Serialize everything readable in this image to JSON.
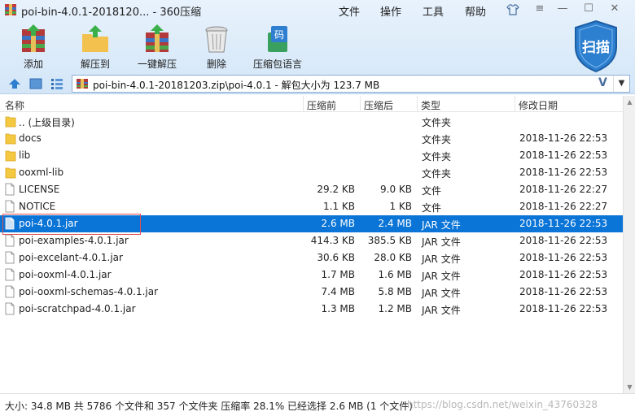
{
  "app": {
    "title": "poi-bin-4.0.1-2018120... - 360压缩"
  },
  "menu": [
    "文件",
    "操作",
    "工具",
    "帮助"
  ],
  "toolbar": {
    "add": "添加",
    "extract_to": "解压到",
    "one_click_extract": "一键解压",
    "delete": "删除",
    "password": "压缩包语言"
  },
  "scan": {
    "label": "扫描"
  },
  "address": {
    "path": "poi-bin-4.0.1-20181203.zip\\poi-4.0.1 - 解包大小为 123.7 MB",
    "v": "V"
  },
  "columns": {
    "name": "名称",
    "packed": "压缩前",
    "unpacked": "压缩后",
    "type": "类型",
    "modified": "修改日期"
  },
  "rows": [
    {
      "icon": "folder-icon",
      "name": ".. (上级目录)",
      "packed": "",
      "unpacked": "",
      "type": "文件夹",
      "date": ""
    },
    {
      "icon": "folder-icon",
      "name": "docs",
      "packed": "",
      "unpacked": "",
      "type": "文件夹",
      "date": "2018-11-26 22:53"
    },
    {
      "icon": "folder-icon",
      "name": "lib",
      "packed": "",
      "unpacked": "",
      "type": "文件夹",
      "date": "2018-11-26 22:53"
    },
    {
      "icon": "folder-icon",
      "name": "ooxml-lib",
      "packed": "",
      "unpacked": "",
      "type": "文件夹",
      "date": "2018-11-26 22:53"
    },
    {
      "icon": "file-icon",
      "name": "LICENSE",
      "packed": "29.2 KB",
      "unpacked": "9.0 KB",
      "type": "文件",
      "date": "2018-11-26 22:27"
    },
    {
      "icon": "file-icon",
      "name": "NOTICE",
      "packed": "1.1 KB",
      "unpacked": "1 KB",
      "type": "文件",
      "date": "2018-11-26 22:27"
    },
    {
      "icon": "file-icon",
      "name": "poi-4.0.1.jar",
      "packed": "2.6 MB",
      "unpacked": "2.4 MB",
      "type": "JAR 文件",
      "date": "2018-11-26 22:53"
    },
    {
      "icon": "file-icon",
      "name": "poi-examples-4.0.1.jar",
      "packed": "414.3 KB",
      "unpacked": "385.5 KB",
      "type": "JAR 文件",
      "date": "2018-11-26 22:53"
    },
    {
      "icon": "file-icon",
      "name": "poi-excelant-4.0.1.jar",
      "packed": "30.6 KB",
      "unpacked": "28.0 KB",
      "type": "JAR 文件",
      "date": "2018-11-26 22:53"
    },
    {
      "icon": "file-icon",
      "name": "poi-ooxml-4.0.1.jar",
      "packed": "1.7 MB",
      "unpacked": "1.6 MB",
      "type": "JAR 文件",
      "date": "2018-11-26 22:53"
    },
    {
      "icon": "file-icon",
      "name": "poi-ooxml-schemas-4.0.1.jar",
      "packed": "7.4 MB",
      "unpacked": "5.8 MB",
      "type": "JAR 文件",
      "date": "2018-11-26 22:53"
    },
    {
      "icon": "file-icon",
      "name": "poi-scratchpad-4.0.1.jar",
      "packed": "1.3 MB",
      "unpacked": "1.2 MB",
      "type": "JAR 文件",
      "date": "2018-11-26 22:53"
    }
  ],
  "selected_row": "poi-4.0.1.jar",
  "status": {
    "text": "大小: 34.8 MB 共 5786 个文件和 357 个文件夹 压缩率 28.1% 已经选择 2.6 MB (1 个文件)",
    "watermark": "https://blog.csdn.net/weixin_43760328"
  },
  "colors": {
    "selection": "#0a74d7",
    "folder": "#f5c842",
    "scan_shield": "#2d7fd0"
  }
}
